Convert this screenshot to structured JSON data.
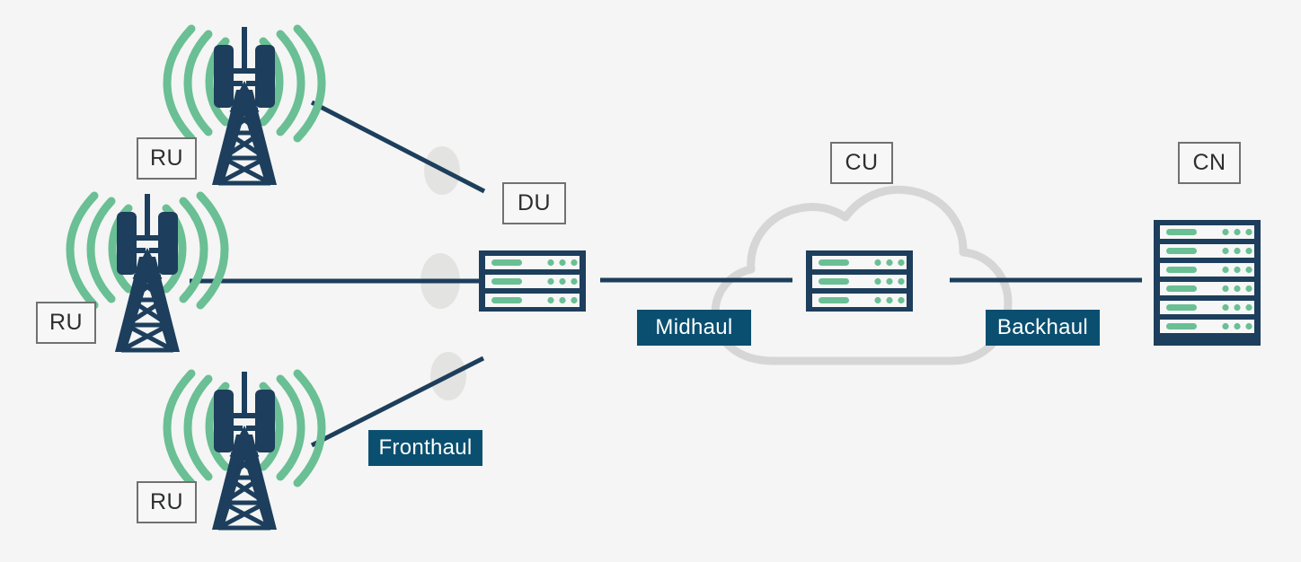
{
  "diagram": {
    "title": "O-RAN fronthaul / midhaul / backhaul topology",
    "background_color": "#f4f5f4",
    "colors": {
      "navy": "#1d3e5c",
      "green": "#6abf94",
      "label_fill": "#0a4f70",
      "label_text": "#ffffff",
      "outline_box_border": "#6f7270",
      "outline_box_text": "#2d2f2e",
      "cloud_outline": "#d6d6d6",
      "ellipse_shadow": "#e3e3e1"
    }
  },
  "node_labels": [
    {
      "id": "ru-top",
      "text": "RU",
      "kind": "outline"
    },
    {
      "id": "ru-middle",
      "text": "RU",
      "kind": "outline"
    },
    {
      "id": "ru-bottom",
      "text": "RU",
      "kind": "outline"
    },
    {
      "id": "du",
      "text": "DU",
      "kind": "outline"
    },
    {
      "id": "cu",
      "text": "CU",
      "kind": "outline"
    },
    {
      "id": "cn",
      "text": "CN",
      "kind": "outline"
    }
  ],
  "link_labels": [
    {
      "id": "fronthaul",
      "text": "Fronthaul",
      "kind": "filled"
    },
    {
      "id": "midhaul",
      "text": "Midhaul",
      "kind": "filled"
    },
    {
      "id": "backhaul",
      "text": "Backhaul",
      "kind": "filled"
    }
  ],
  "icons": {
    "tower": "cell-tower-icon",
    "server_du": "server-rack-icon",
    "server_cu": "server-rack-icon",
    "server_cn": "server-rack-icon",
    "cloud": "cloud-icon"
  },
  "server_units": {
    "du": 3,
    "cu": 3,
    "cn": 6
  },
  "towers": 3
}
